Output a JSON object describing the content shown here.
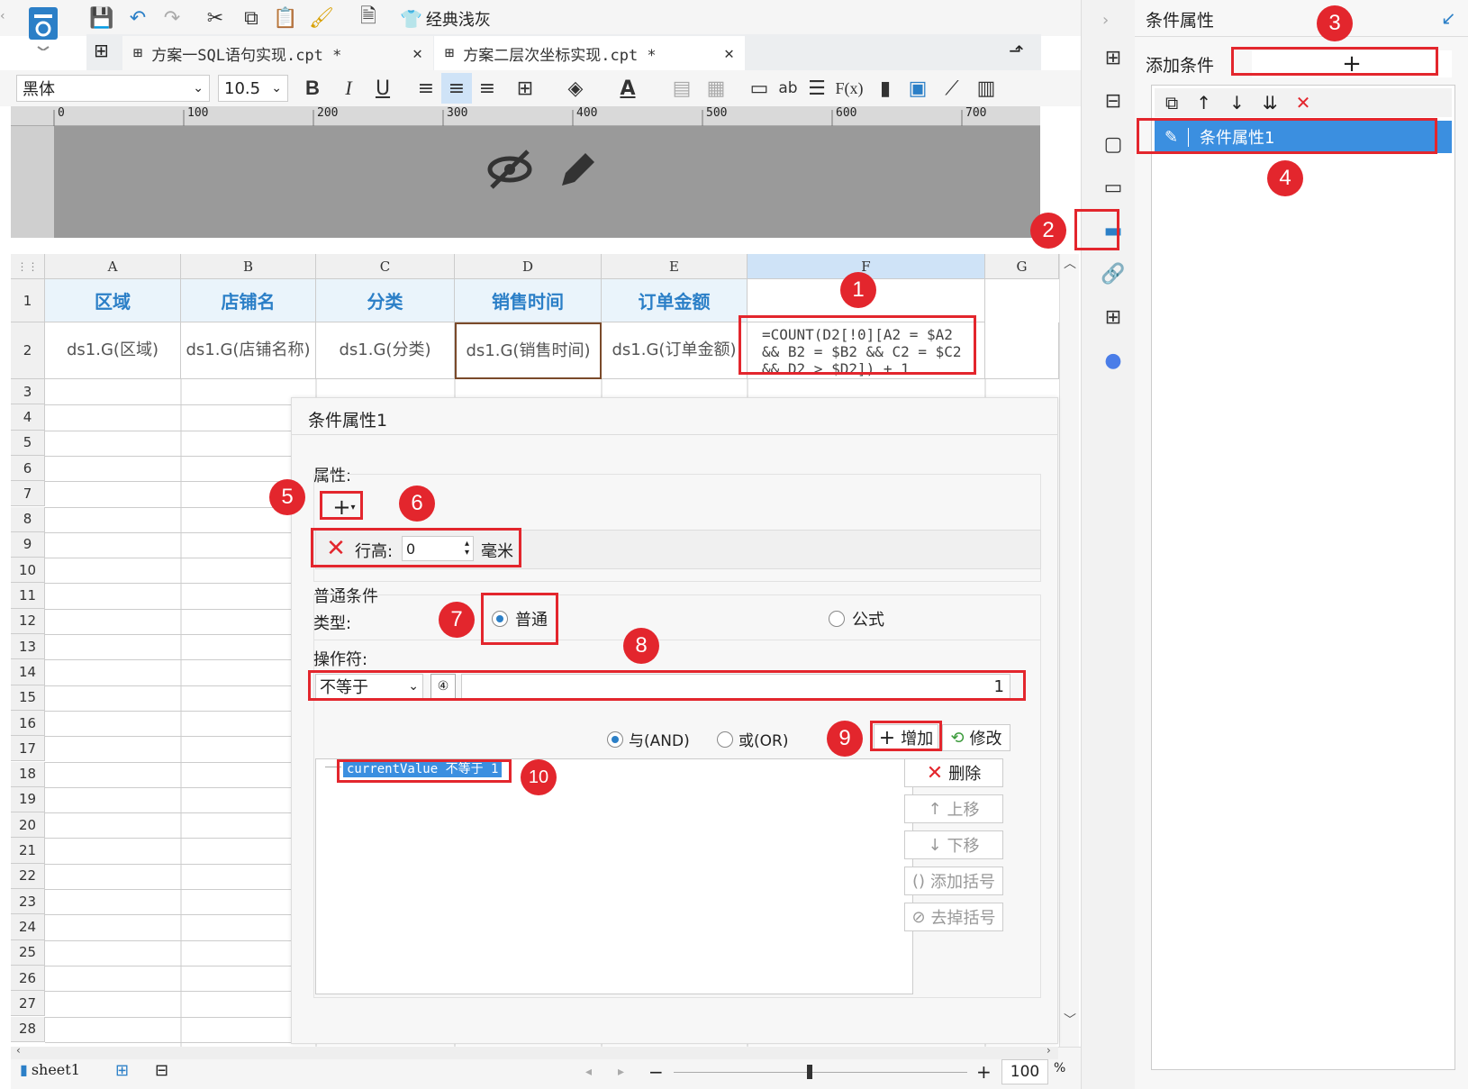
{
  "toolbar": {
    "theme_label": "经典浅灰"
  },
  "tabs": [
    {
      "label": "方案一SQL语句实现.cpt *"
    },
    {
      "label": "方案二层次坐标实现.cpt *"
    }
  ],
  "format_bar": {
    "font_name": "黑体",
    "font_size": "10.5",
    "bold": "B",
    "italic": "I",
    "underline": "U",
    "text_ab": "ab",
    "fx": "F(x)"
  },
  "ruler": [
    "0",
    "100",
    "200",
    "300",
    "400",
    "500",
    "600",
    "700"
  ],
  "grid": {
    "columns": [
      "A",
      "B",
      "C",
      "D",
      "E",
      "F",
      "G"
    ],
    "rows": [
      "1",
      "2",
      "3",
      "4",
      "5",
      "6",
      "7",
      "8",
      "9",
      "10",
      "11",
      "12",
      "13",
      "14",
      "15",
      "16",
      "17",
      "18",
      "19",
      "20",
      "21",
      "22",
      "23",
      "24",
      "25",
      "26",
      "27",
      "28"
    ],
    "header_cells": [
      "区域",
      "店铺名",
      "分类",
      "销售时间",
      "订单金额"
    ],
    "data_cells": [
      "ds1.G(区域)",
      "ds1.G(店铺名称)",
      "ds1.G(分类)",
      "ds1.G(销售时间)",
      "ds1.G(订单金额)"
    ],
    "formula_lines": [
      "=COUNT(D2[!0][A2 = $A2",
      "&& B2 = $B2 && C2 = $C2",
      "&& D2 > $D2]) + 1"
    ]
  },
  "right_panel": {
    "title": "条件属性",
    "add_condition_label": "添加条件",
    "add_symbol": "+",
    "item_label": "条件属性1"
  },
  "dialog": {
    "title": "条件属性1",
    "properties_label": "属性:",
    "row_height_label": "行高:",
    "row_height_value": "0",
    "unit_label": "毫米",
    "normal_condition_label": "普通条件",
    "type_label": "类型:",
    "type_normal": "普通",
    "type_formula": "公式",
    "operator_label": "操作符:",
    "operator_value": "不等于",
    "operand_value": "1",
    "and_label": "与(AND)",
    "or_label": "或(OR)",
    "add_button": "增加",
    "modify_button": "修改",
    "condition_item": "currentValue 不等于 1",
    "delete_button": "删除",
    "move_up_button": "上移",
    "move_down_button": "下移",
    "add_bracket_button": "添加括号",
    "remove_bracket_button": "去掉括号"
  },
  "statusbar": {
    "sheet_name": "sheet1",
    "zoom": "100",
    "zoom_unit": "%"
  },
  "markers": [
    "1",
    "2",
    "3",
    "4",
    "5",
    "6",
    "7",
    "8",
    "9",
    "10"
  ],
  "colors": {
    "accent": "#2b7fc7",
    "annotation_red": "#e3262d",
    "selected_item": "#3b8fe0"
  }
}
